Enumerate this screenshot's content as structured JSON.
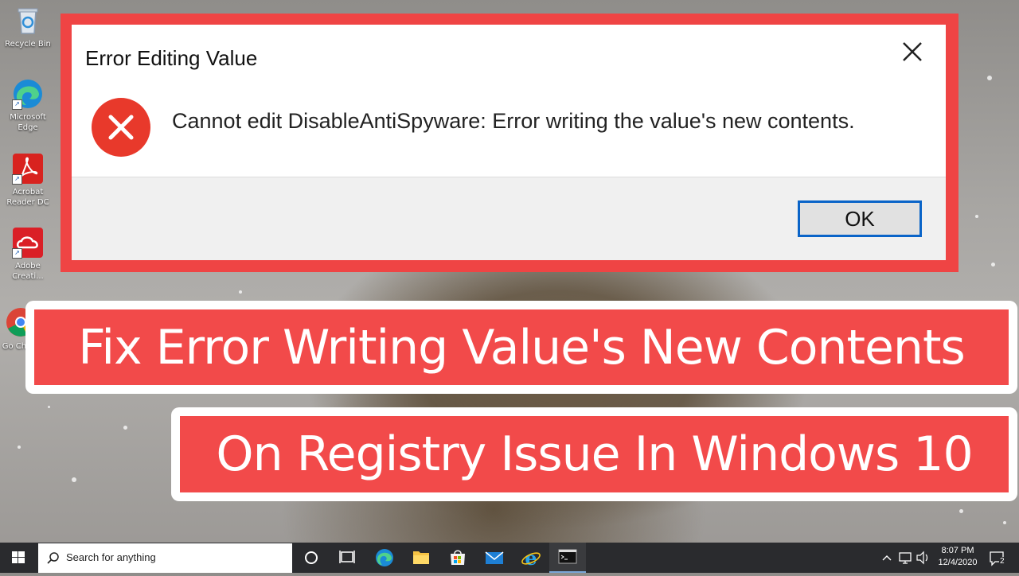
{
  "desktop": {
    "icons": [
      {
        "label": "Recycle Bin"
      },
      {
        "label": "Microsoft Edge"
      },
      {
        "label": "Acrobat Reader DC"
      },
      {
        "label": "Adobe Creati..."
      },
      {
        "label": "Go Chr"
      }
    ]
  },
  "dialog": {
    "title": "Error Editing Value",
    "message": "Cannot edit DisableAntiSpyware:  Error writing the value's new contents.",
    "ok_label": "OK",
    "icon": "error-icon",
    "frame_color": "#ef4444"
  },
  "banners": {
    "line1": "Fix Error Writing Value's New Contents",
    "line2": "On Registry Issue In Windows 10",
    "color": "#f24a4a"
  },
  "taskbar": {
    "search_placeholder": "Search for anything",
    "pinned": [
      "task-view-icon",
      "edge-icon",
      "file-explorer-icon",
      "store-icon",
      "mail-icon",
      "internet-explorer-icon",
      "terminal-icon"
    ],
    "clock_time": "8:07 PM",
    "clock_date": "12/4/2020",
    "notification_count": "2"
  }
}
